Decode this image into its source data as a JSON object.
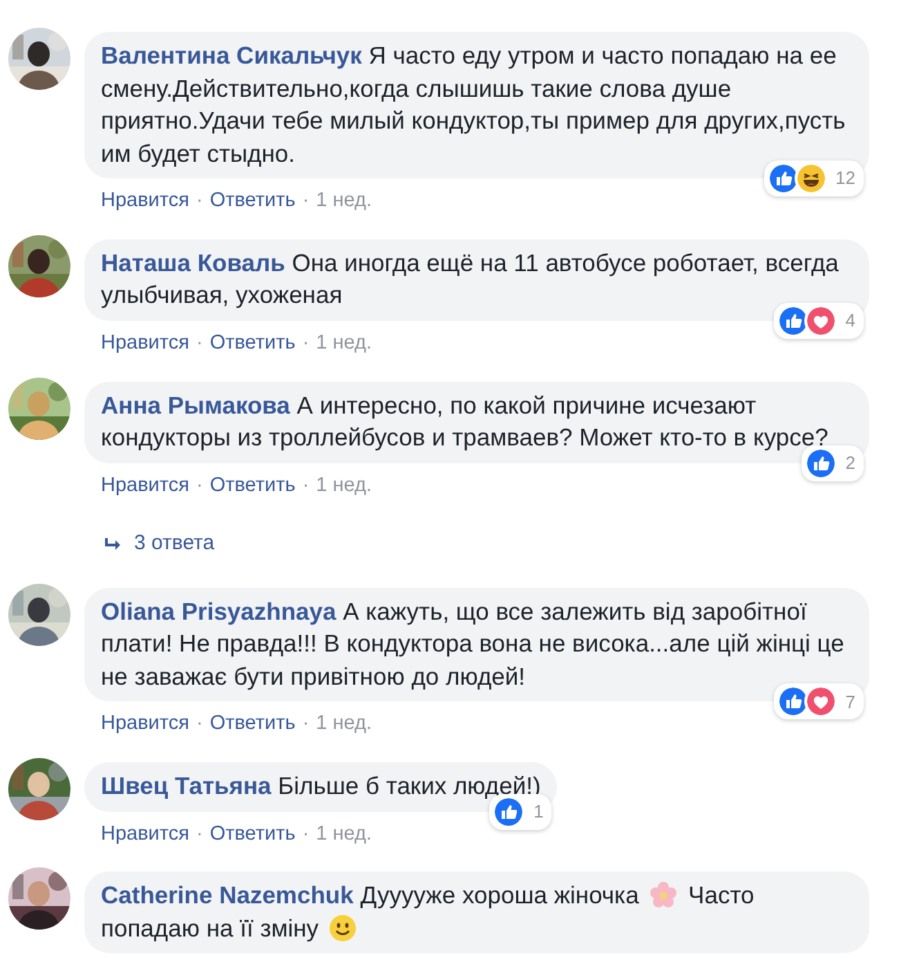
{
  "comments": [
    {
      "author": "Валентина Сикальчук",
      "text": [
        {
          "kind": "text",
          "text": "Я часто еду утром и часто попадаю на ее смену.Действительно,когда слышишь такие слова душе приятно.Удачи тебе милый кондуктор,ты пример для других,пусть им будет стыдно."
        }
      ],
      "reactions": {
        "types": [
          {
            "kind": "like"
          },
          {
            "kind": "haha"
          }
        ],
        "count": "12"
      },
      "actions": [
        "Нравится",
        "Ответить"
      ],
      "separator": "·",
      "time": "1 нед."
    },
    {
      "author": "Наташа Коваль",
      "text": [
        {
          "kind": "text",
          "text": "Она иногда ещё на 11 автобусе роботает, всегда улыбчивая, ухоженая"
        }
      ],
      "reactions": {
        "types": [
          {
            "kind": "like"
          },
          {
            "kind": "love"
          }
        ],
        "count": "4"
      },
      "actions": [
        "Нравится",
        "Ответить"
      ],
      "separator": "·",
      "time": "1 нед."
    },
    {
      "author": "Анна Рымакова",
      "text": [
        {
          "kind": "text",
          "text": "А интересно, по какой причине исчезают кондукторы из троллейбусов и трамваев? Может кто-то в курсе?"
        }
      ],
      "reactions": {
        "types": [
          {
            "kind": "like"
          }
        ],
        "count": "2"
      },
      "actions": [
        "Нравится",
        "Ответить"
      ],
      "separator": "·",
      "time": "1 нед.",
      "replies": "3 ответа"
    },
    {
      "author": "Oliana Prisyazhnaya",
      "text": [
        {
          "kind": "text",
          "text": "А кажуть, що все залежить від заробітної плати! Не правда!!! В кондуктора вона не висока...але цій жінці це не заважає бути привітною до людей!"
        }
      ],
      "reactions": {
        "types": [
          {
            "kind": "like"
          },
          {
            "kind": "love"
          }
        ],
        "count": "7"
      },
      "actions": [
        "Нравится",
        "Ответить"
      ],
      "separator": "·",
      "time": "1 нед."
    },
    {
      "author": "Швец Татьяна",
      "text": [
        {
          "kind": "text",
          "text": "Більше б таких людей!)"
        }
      ],
      "reactions": {
        "types": [
          {
            "kind": "like"
          }
        ],
        "count": "1"
      },
      "actions": [
        "Нравится",
        "Ответить"
      ],
      "separator": "·",
      "time": "1 нед."
    },
    {
      "author": "Catherine Nazemchuk",
      "text": [
        {
          "kind": "text",
          "text": "Дууууже хороша жіночка"
        },
        {
          "kind": "flower"
        },
        {
          "kind": "text",
          "text": "Часто попадаю на її зміну"
        },
        {
          "kind": "smile"
        }
      ]
    }
  ]
}
